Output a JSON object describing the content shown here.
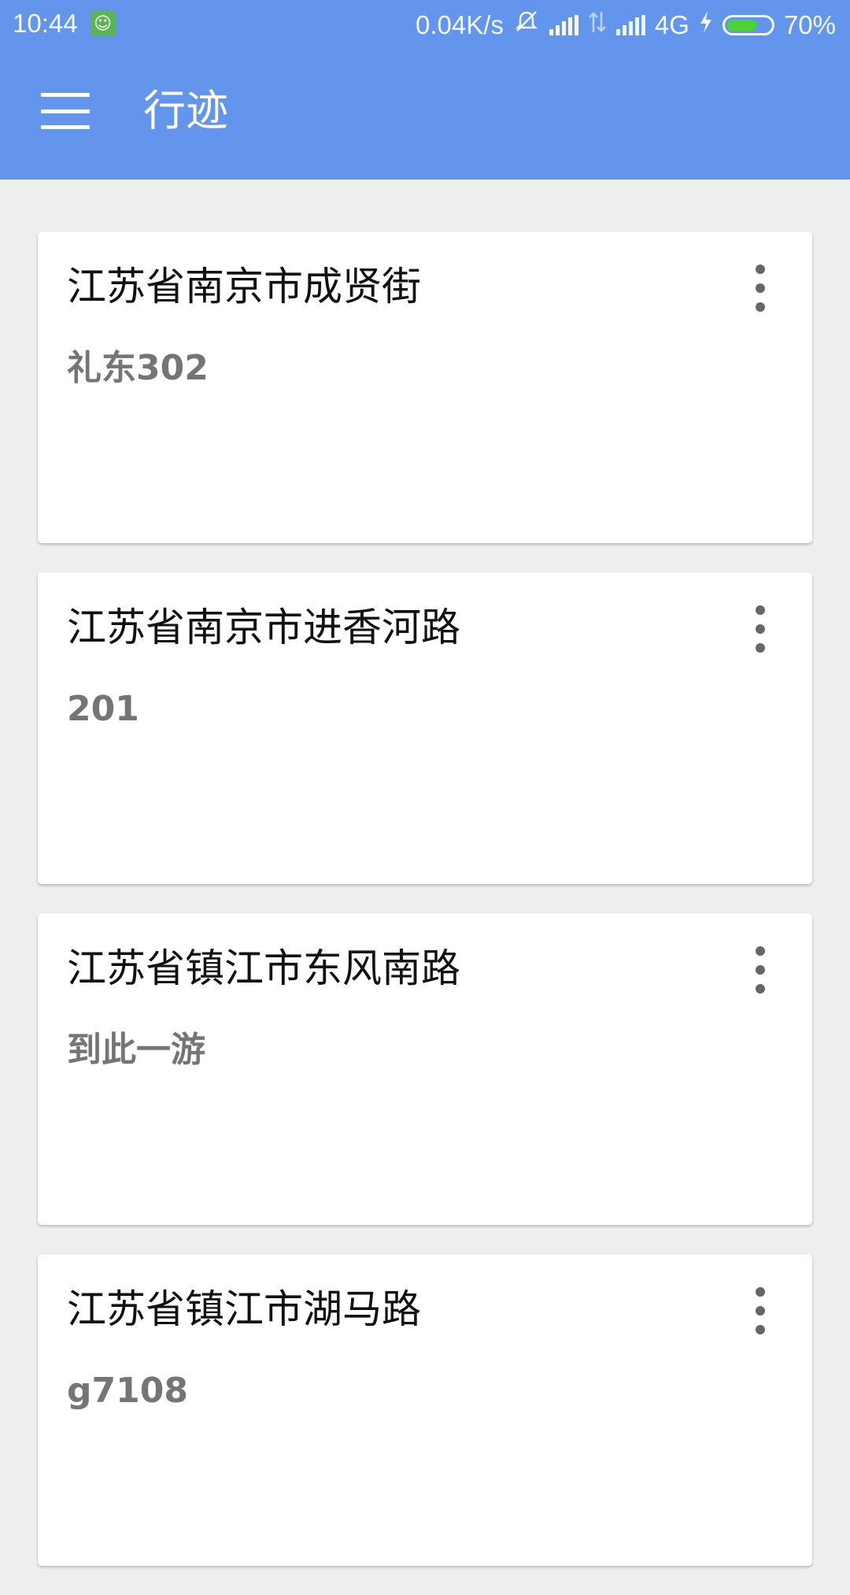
{
  "status_bar": {
    "time": "10:44",
    "network_speed": "0.04K/s",
    "network_type": "4G",
    "battery": "70%",
    "battery_level": 0.7,
    "icons": [
      "app-badge-icon",
      "vibrate-icon",
      "signal-icon",
      "data-transfer-icon",
      "signal-icon",
      "charging-icon",
      "battery-icon"
    ]
  },
  "app_bar": {
    "title": "行迹",
    "menu_icon": "hamburger-menu-icon"
  },
  "cards": [
    {
      "title": "江苏省南京市成贤街",
      "subtitle": "礼东302",
      "more_icon": "more-vert-icon"
    },
    {
      "title": "江苏省南京市进香河路",
      "subtitle": "201",
      "more_icon": "more-vert-icon"
    },
    {
      "title": "江苏省镇江市东风南路",
      "subtitle": "到此一游",
      "more_icon": "more-vert-icon"
    },
    {
      "title": "江苏省镇江市湖马路",
      "subtitle": "g7108",
      "more_icon": "more-vert-icon"
    }
  ],
  "colors": {
    "app_bar": "#6495ed",
    "background": "#eeeeee",
    "card": "#ffffff",
    "subtitle": "#757575",
    "battery_fill": "#4cd137"
  }
}
